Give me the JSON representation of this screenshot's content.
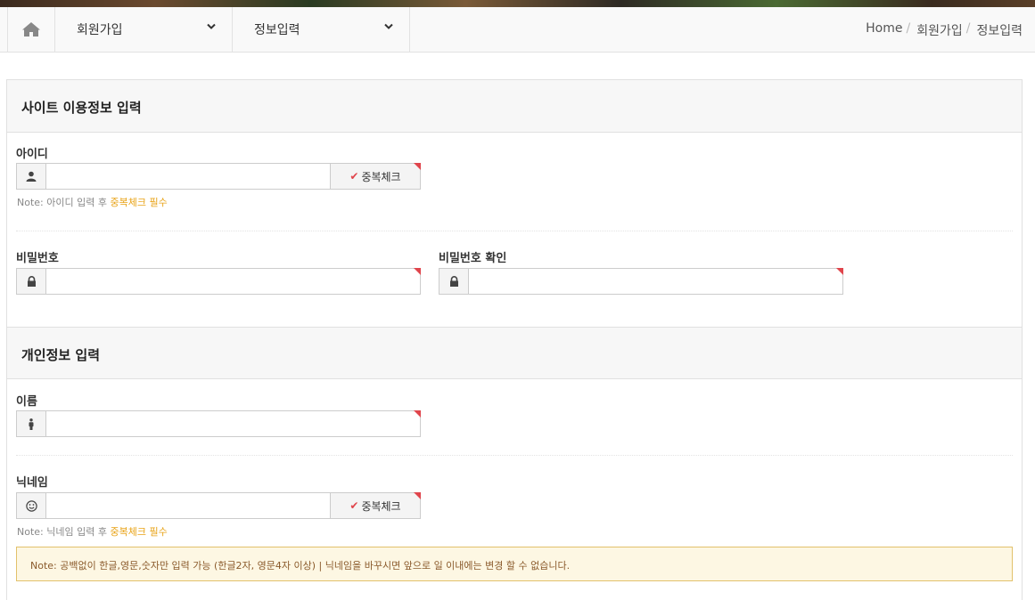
{
  "nav": {
    "home_icon": "home-icon",
    "menu1": "회원가입",
    "menu2": "정보입력",
    "breadcrumb": [
      "Home",
      "회원가입",
      "정보입력"
    ]
  },
  "section1": {
    "title": "사이트 이용정보 입력",
    "id_label": "아이디",
    "id_value": "",
    "dup_check": "중복체크",
    "id_note_prefix": "Note:",
    "id_note_text": "아이디 입력 후",
    "id_note_highlight": "중복체크 필수",
    "pw_label": "비밀번호",
    "pw_confirm_label": "비밀번호 확인"
  },
  "section2": {
    "title": "개인정보 입력",
    "name_label": "이름",
    "nick_label": "닉네임",
    "dup_check": "중복체크",
    "nick_note_prefix": "Note:",
    "nick_note_text": "닉네임 입력 후",
    "nick_note_highlight": "중복체크 필수",
    "alert_prefix": "Note:",
    "alert_text": "공백없이 한글,영문,숫자만 입력 가능 (한글2자, 영문4자 이상) | 닉네임을 바꾸시면 앞으로 일 이내에는 변경 할 수 없습니다."
  },
  "colors": {
    "required_marker": "#e0454c",
    "highlight": "#e8a317",
    "alert_bg": "#fdf7e3",
    "alert_border": "#e2c16b"
  }
}
